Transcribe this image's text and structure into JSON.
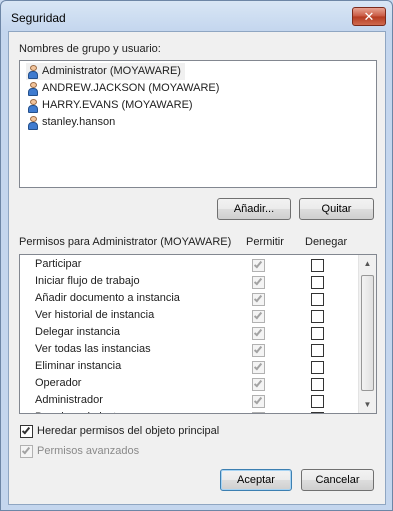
{
  "window": {
    "title": "Seguridad",
    "close_glyph": "✕"
  },
  "groups_label": "Nombres de grupo y usuario:",
  "users": [
    {
      "name": "Administrator (MOYAWARE)",
      "icon": "user-icon",
      "selected": true
    },
    {
      "name": "ANDREW.JACKSON (MOYAWARE)",
      "icon": "user-icon",
      "selected": false
    },
    {
      "name": "HARRY.EVANS (MOYAWARE)",
      "icon": "user-icon",
      "selected": false
    },
    {
      "name": "stanley.hanson",
      "icon": "user-icon",
      "selected": false
    }
  ],
  "buttons": {
    "add": "Añadir...",
    "remove": "Quitar",
    "accept": "Aceptar",
    "cancel": "Cancelar"
  },
  "permissions": {
    "header_label": "Permisos para Administrator (MOYAWARE)",
    "allow_header": "Permitir",
    "deny_header": "Denegar",
    "rows": [
      {
        "name": "Participar",
        "allow": true,
        "deny": false
      },
      {
        "name": "Iniciar flujo de trabajo",
        "allow": true,
        "deny": false
      },
      {
        "name": "Añadir documento a instancia",
        "allow": true,
        "deny": false
      },
      {
        "name": "Ver historial de instancia",
        "allow": true,
        "deny": false
      },
      {
        "name": "Delegar instancia",
        "allow": true,
        "deny": false
      },
      {
        "name": "Ver todas las instancias",
        "allow": true,
        "deny": false
      },
      {
        "name": "Eliminar instancia",
        "allow": true,
        "deny": false
      },
      {
        "name": "Operador",
        "allow": true,
        "deny": false
      },
      {
        "name": "Administrador",
        "allow": true,
        "deny": false
      },
      {
        "name": "Permisos de lectura",
        "allow": true,
        "deny": false
      }
    ]
  },
  "inherit": {
    "label": "Heredar permisos del objeto principal",
    "checked": true
  },
  "advanced": {
    "label": "Permisos avanzados",
    "checked": true,
    "enabled": false
  }
}
